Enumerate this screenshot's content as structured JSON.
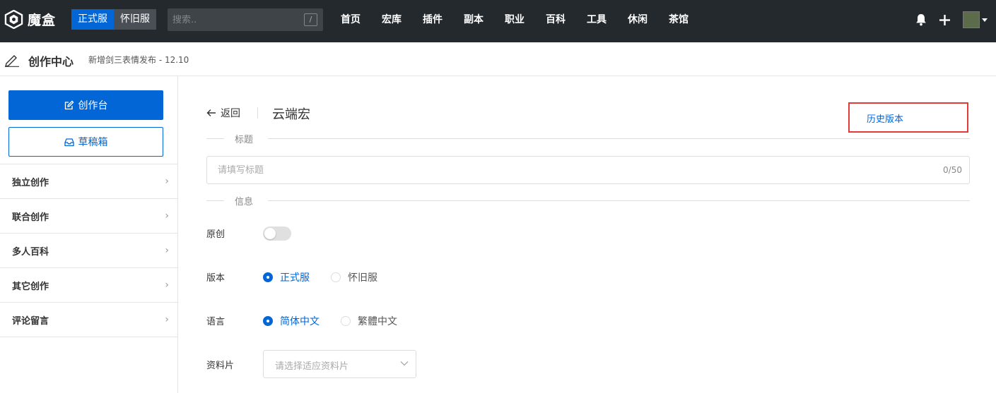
{
  "topbar": {
    "logo_text": "魔盒",
    "server_active": "正式服",
    "server_inactive": "怀旧服",
    "search_placeholder": "搜索..",
    "search_shortcut": "/",
    "nav": [
      "首页",
      "宏库",
      "插件",
      "副本",
      "职业",
      "百科",
      "工具",
      "休闲",
      "茶馆"
    ]
  },
  "subheader": {
    "title": "创作中心",
    "notice": "新增剑三表情发布 - 12.10"
  },
  "sidebar": {
    "primary_button": "创作台",
    "draft_button": "草稿箱",
    "items": [
      "独立创作",
      "联合创作",
      "多人百科",
      "其它创作",
      "评论留言"
    ]
  },
  "main": {
    "back_label": "返回",
    "page_title": "云端宏",
    "history_link": "历史版本",
    "section_title": "标题",
    "title_placeholder": "请填写标题",
    "title_count": "0/50",
    "section_info": "信息",
    "original_label": "原创",
    "original_on": false,
    "version_label": "版本",
    "version_options": [
      "正式服",
      "怀旧服"
    ],
    "version_selected": "正式服",
    "language_label": "语言",
    "language_options": [
      "简体中文",
      "繁體中文"
    ],
    "language_selected": "简体中文",
    "profile_label": "资料片",
    "profile_placeholder": "请选择适应资料片"
  },
  "colors": {
    "topbar_bg": "#24292e",
    "accent": "#0366d6",
    "highlight_border": "#e53935"
  }
}
